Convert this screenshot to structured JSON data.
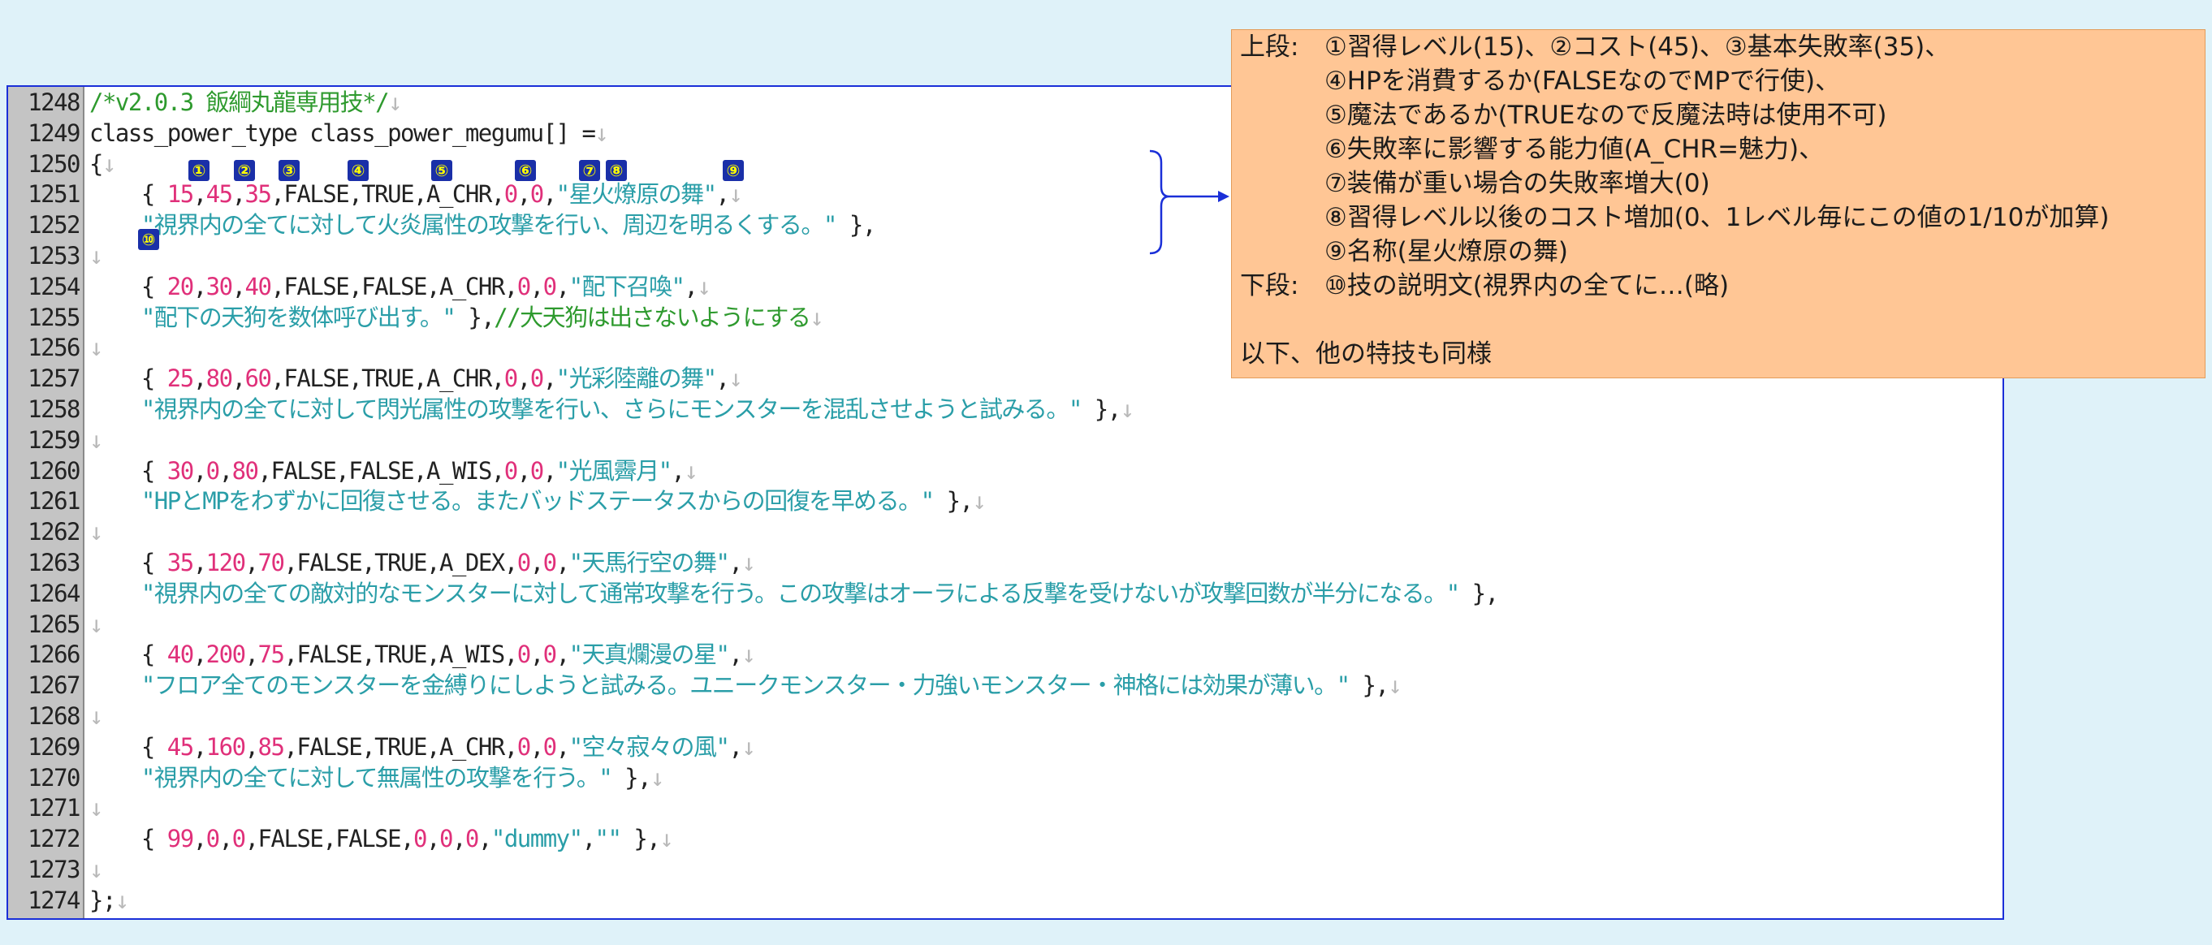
{
  "colors": {
    "background": "#dff2f9",
    "editor_border": "#1a2fd8",
    "gutter": "#c4c4c4",
    "comment": "#2e9a2e",
    "number": "#e0307a",
    "string": "#2a9ea8",
    "annotation_bg": "#ffc695",
    "badge_bg": "#1a2fa8",
    "badge_fg": "#ffff00"
  },
  "lines": [
    {
      "num": "1248",
      "tokens": [
        {
          "t": "/*v2.0.3 飯綱丸龍専用技*/",
          "c": "cm"
        },
        {
          "t": "↓",
          "c": "m"
        }
      ]
    },
    {
      "num": "1249",
      "tokens": [
        {
          "t": "class_power_type class_power_megumu[] =",
          "c": "k"
        },
        {
          "t": "↓",
          "c": "m"
        }
      ]
    },
    {
      "num": "1250",
      "tokens": [
        {
          "t": "{",
          "c": "p"
        },
        {
          "t": "↓",
          "c": "m"
        }
      ]
    },
    {
      "num": "1251",
      "tokens": [
        {
          "t": "    { ",
          "c": "p"
        },
        {
          "t": "15",
          "c": "n"
        },
        {
          "t": ",",
          "c": "p"
        },
        {
          "t": "45",
          "c": "n"
        },
        {
          "t": ",",
          "c": "p"
        },
        {
          "t": "35",
          "c": "n"
        },
        {
          "t": ",FALSE,TRUE,A_CHR,",
          "c": "p"
        },
        {
          "t": "0",
          "c": "n"
        },
        {
          "t": ",",
          "c": "p"
        },
        {
          "t": "0",
          "c": "n"
        },
        {
          "t": ",",
          "c": "p"
        },
        {
          "t": "\"星火燎原の舞\"",
          "c": "s"
        },
        {
          "t": ",",
          "c": "p"
        },
        {
          "t": "↓",
          "c": "m"
        }
      ]
    },
    {
      "num": "1252",
      "tokens": [
        {
          "t": "    ",
          "c": "p"
        },
        {
          "t": "\"視界内の全てに対して火炎属性の攻撃を行い、周辺を明るくする。\"",
          "c": "s"
        },
        {
          "t": " },",
          "c": "p"
        }
      ]
    },
    {
      "num": "1253",
      "tokens": [
        {
          "t": "↓",
          "c": "m"
        }
      ]
    },
    {
      "num": "1254",
      "tokens": [
        {
          "t": "    { ",
          "c": "p"
        },
        {
          "t": "20",
          "c": "n"
        },
        {
          "t": ",",
          "c": "p"
        },
        {
          "t": "30",
          "c": "n"
        },
        {
          "t": ",",
          "c": "p"
        },
        {
          "t": "40",
          "c": "n"
        },
        {
          "t": ",FALSE,FALSE,A_CHR,",
          "c": "p"
        },
        {
          "t": "0",
          "c": "n"
        },
        {
          "t": ",",
          "c": "p"
        },
        {
          "t": "0",
          "c": "n"
        },
        {
          "t": ",",
          "c": "p"
        },
        {
          "t": "\"配下召喚\"",
          "c": "s"
        },
        {
          "t": ",",
          "c": "p"
        },
        {
          "t": "↓",
          "c": "m"
        }
      ]
    },
    {
      "num": "1255",
      "tokens": [
        {
          "t": "    ",
          "c": "p"
        },
        {
          "t": "\"配下の天狗を数体呼び出す。\"",
          "c": "s"
        },
        {
          "t": " },",
          "c": "p"
        },
        {
          "t": "//大天狗は出さないようにする",
          "c": "cm"
        },
        {
          "t": "↓",
          "c": "m"
        }
      ]
    },
    {
      "num": "1256",
      "tokens": [
        {
          "t": "↓",
          "c": "m"
        }
      ]
    },
    {
      "num": "1257",
      "tokens": [
        {
          "t": "    { ",
          "c": "p"
        },
        {
          "t": "25",
          "c": "n"
        },
        {
          "t": ",",
          "c": "p"
        },
        {
          "t": "80",
          "c": "n"
        },
        {
          "t": ",",
          "c": "p"
        },
        {
          "t": "60",
          "c": "n"
        },
        {
          "t": ",FALSE,TRUE,A_CHR,",
          "c": "p"
        },
        {
          "t": "0",
          "c": "n"
        },
        {
          "t": ",",
          "c": "p"
        },
        {
          "t": "0",
          "c": "n"
        },
        {
          "t": ",",
          "c": "p"
        },
        {
          "t": "\"光彩陸離の舞\"",
          "c": "s"
        },
        {
          "t": ",",
          "c": "p"
        },
        {
          "t": "↓",
          "c": "m"
        }
      ]
    },
    {
      "num": "1258",
      "tokens": [
        {
          "t": "    ",
          "c": "p"
        },
        {
          "t": "\"視界内の全てに対して閃光属性の攻撃を行い、さらにモンスターを混乱させようと試みる。\"",
          "c": "s"
        },
        {
          "t": " },",
          "c": "p"
        },
        {
          "t": "↓",
          "c": "m"
        }
      ]
    },
    {
      "num": "1259",
      "tokens": [
        {
          "t": "↓",
          "c": "m"
        }
      ]
    },
    {
      "num": "1260",
      "tokens": [
        {
          "t": "    { ",
          "c": "p"
        },
        {
          "t": "30",
          "c": "n"
        },
        {
          "t": ",",
          "c": "p"
        },
        {
          "t": "0",
          "c": "n"
        },
        {
          "t": ",",
          "c": "p"
        },
        {
          "t": "80",
          "c": "n"
        },
        {
          "t": ",FALSE,FALSE,A_WIS,",
          "c": "p"
        },
        {
          "t": "0",
          "c": "n"
        },
        {
          "t": ",",
          "c": "p"
        },
        {
          "t": "0",
          "c": "n"
        },
        {
          "t": ",",
          "c": "p"
        },
        {
          "t": "\"光風霽月\"",
          "c": "s"
        },
        {
          "t": ",",
          "c": "p"
        },
        {
          "t": "↓",
          "c": "m"
        }
      ]
    },
    {
      "num": "1261",
      "tokens": [
        {
          "t": "    ",
          "c": "p"
        },
        {
          "t": "\"HPとMPをわずかに回復させる。またバッドステータスからの回復を早める。\"",
          "c": "s"
        },
        {
          "t": " },",
          "c": "p"
        },
        {
          "t": "↓",
          "c": "m"
        }
      ]
    },
    {
      "num": "1262",
      "tokens": [
        {
          "t": "↓",
          "c": "m"
        }
      ]
    },
    {
      "num": "1263",
      "tokens": [
        {
          "t": "    { ",
          "c": "p"
        },
        {
          "t": "35",
          "c": "n"
        },
        {
          "t": ",",
          "c": "p"
        },
        {
          "t": "120",
          "c": "n"
        },
        {
          "t": ",",
          "c": "p"
        },
        {
          "t": "70",
          "c": "n"
        },
        {
          "t": ",FALSE,TRUE,A_DEX,",
          "c": "p"
        },
        {
          "t": "0",
          "c": "n"
        },
        {
          "t": ",",
          "c": "p"
        },
        {
          "t": "0",
          "c": "n"
        },
        {
          "t": ",",
          "c": "p"
        },
        {
          "t": "\"天馬行空の舞\"",
          "c": "s"
        },
        {
          "t": ",",
          "c": "p"
        },
        {
          "t": "↓",
          "c": "m"
        }
      ]
    },
    {
      "num": "1264",
      "tokens": [
        {
          "t": "    ",
          "c": "p"
        },
        {
          "t": "\"視界内の全ての敵対的なモンスターに対して通常攻撃を行う。この攻撃はオーラによる反撃を受けないが攻撃回数が半分になる。\"",
          "c": "s"
        },
        {
          "t": " },",
          "c": "p"
        }
      ]
    },
    {
      "num": "1265",
      "tokens": [
        {
          "t": "↓",
          "c": "m"
        }
      ]
    },
    {
      "num": "1266",
      "tokens": [
        {
          "t": "    { ",
          "c": "p"
        },
        {
          "t": "40",
          "c": "n"
        },
        {
          "t": ",",
          "c": "p"
        },
        {
          "t": "200",
          "c": "n"
        },
        {
          "t": ",",
          "c": "p"
        },
        {
          "t": "75",
          "c": "n"
        },
        {
          "t": ",FALSE,TRUE,A_WIS,",
          "c": "p"
        },
        {
          "t": "0",
          "c": "n"
        },
        {
          "t": ",",
          "c": "p"
        },
        {
          "t": "0",
          "c": "n"
        },
        {
          "t": ",",
          "c": "p"
        },
        {
          "t": "\"天真爛漫の星\"",
          "c": "s"
        },
        {
          "t": ",",
          "c": "p"
        },
        {
          "t": "↓",
          "c": "m"
        }
      ]
    },
    {
      "num": "1267",
      "tokens": [
        {
          "t": "    ",
          "c": "p"
        },
        {
          "t": "\"フロア全てのモンスターを金縛りにしようと試みる。ユニークモンスター・力強いモンスター・神格には効果が薄い。\"",
          "c": "s"
        },
        {
          "t": " },",
          "c": "p"
        },
        {
          "t": "↓",
          "c": "m"
        }
      ]
    },
    {
      "num": "1268",
      "tokens": [
        {
          "t": "↓",
          "c": "m"
        }
      ]
    },
    {
      "num": "1269",
      "tokens": [
        {
          "t": "    { ",
          "c": "p"
        },
        {
          "t": "45",
          "c": "n"
        },
        {
          "t": ",",
          "c": "p"
        },
        {
          "t": "160",
          "c": "n"
        },
        {
          "t": ",",
          "c": "p"
        },
        {
          "t": "85",
          "c": "n"
        },
        {
          "t": ",FALSE,TRUE,A_CHR,",
          "c": "p"
        },
        {
          "t": "0",
          "c": "n"
        },
        {
          "t": ",",
          "c": "p"
        },
        {
          "t": "0",
          "c": "n"
        },
        {
          "t": ",",
          "c": "p"
        },
        {
          "t": "\"空々寂々の風\"",
          "c": "s"
        },
        {
          "t": ",",
          "c": "p"
        },
        {
          "t": "↓",
          "c": "m"
        }
      ]
    },
    {
      "num": "1270",
      "tokens": [
        {
          "t": "    ",
          "c": "p"
        },
        {
          "t": "\"視界内の全てに対して無属性の攻撃を行う。\"",
          "c": "s"
        },
        {
          "t": " },",
          "c": "p"
        },
        {
          "t": "↓",
          "c": "m"
        }
      ]
    },
    {
      "num": "1271",
      "tokens": [
        {
          "t": "↓",
          "c": "m"
        }
      ]
    },
    {
      "num": "1272",
      "tokens": [
        {
          "t": "    { ",
          "c": "p"
        },
        {
          "t": "99",
          "c": "n"
        },
        {
          "t": ",",
          "c": "p"
        },
        {
          "t": "0",
          "c": "n"
        },
        {
          "t": ",",
          "c": "p"
        },
        {
          "t": "0",
          "c": "n"
        },
        {
          "t": ",FALSE,FALSE,",
          "c": "p"
        },
        {
          "t": "0",
          "c": "n"
        },
        {
          "t": ",",
          "c": "p"
        },
        {
          "t": "0",
          "c": "n"
        },
        {
          "t": ",",
          "c": "p"
        },
        {
          "t": "0",
          "c": "n"
        },
        {
          "t": ",",
          "c": "p"
        },
        {
          "t": "\"dummy\"",
          "c": "s"
        },
        {
          "t": ",",
          "c": "p"
        },
        {
          "t": "\"\"",
          "c": "s"
        },
        {
          "t": " },",
          "c": "p"
        },
        {
          "t": "↓",
          "c": "m"
        }
      ]
    },
    {
      "num": "1273",
      "tokens": [
        {
          "t": "↓",
          "c": "m"
        }
      ]
    },
    {
      "num": "1274",
      "tokens": [
        {
          "t": "};",
          "c": "p"
        },
        {
          "t": "↓",
          "c": "m"
        }
      ]
    }
  ],
  "markers": [
    "①",
    "②",
    "③",
    "④",
    "⑤",
    "⑥",
    "⑦",
    "⑧",
    "⑨",
    "⑩"
  ],
  "annotation": {
    "upper_label": "上段:",
    "upper_items": [
      "①習得レベル(15)、②コスト(45)、③基本失敗率(35)、",
      "④HPを消費するか(FALSEなのでMPで行使)、",
      "⑤魔法であるか(TRUEなので反魔法時は使用不可)",
      "⑥失敗率に影響する能力値(A_CHR=魅力)、",
      "⑦装備が重い場合の失敗率増大(0)",
      "⑧習得レベル以後のコスト増加(0、1レベル毎にこの値の1/10が加算)",
      "⑨名称(星火燎原の舞)"
    ],
    "lower_label": "下段:",
    "lower_item": "⑩技の説明文(視界内の全てに…(略)",
    "footer": "以下、他の特技も同様"
  }
}
